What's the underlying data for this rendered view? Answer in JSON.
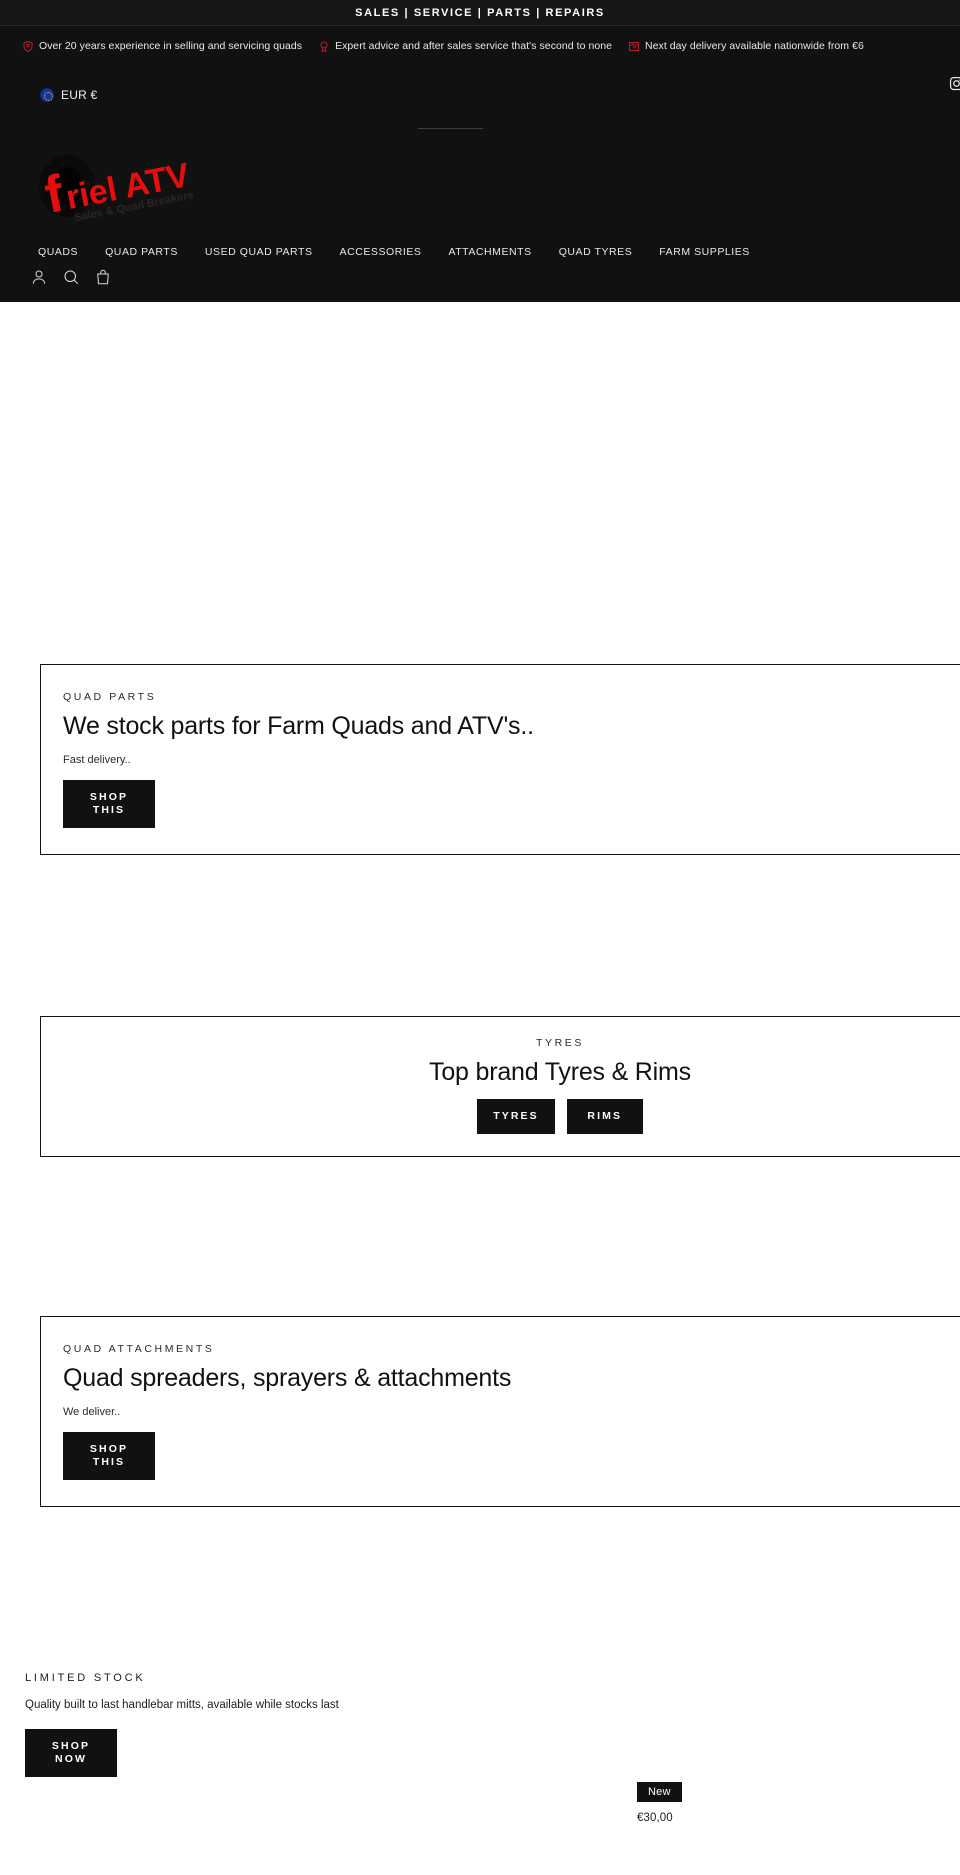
{
  "announcement": {
    "text": "SALES | SERVICE | PARTS | REPAIRS"
  },
  "usp": {
    "items": [
      {
        "icon": "shield-icon",
        "text": "Over 20 years experience in selling and servicing quads"
      },
      {
        "icon": "medal-icon",
        "text": "Expert advice and after sales service that's second to none"
      },
      {
        "icon": "delivery-box-icon",
        "text": "Next day delivery available nationwide from €6"
      }
    ]
  },
  "utility": {
    "currency": {
      "label": "EUR €",
      "flag": "eu-flag-icon"
    },
    "socials": [
      {
        "icon": "instagram-icon",
        "name": "Instagram"
      }
    ]
  },
  "logo": {
    "word_f": "f",
    "word_main": "riel ATV",
    "tagline": "Sales & Quad Breakers",
    "color": "#e80d0d"
  },
  "nav": {
    "items": [
      {
        "label": "QUADS"
      },
      {
        "label": "QUAD PARTS"
      },
      {
        "label": "USED QUAD PARTS"
      },
      {
        "label": "ACCESSORIES"
      },
      {
        "label": "ATTACHMENTS"
      },
      {
        "label": "QUAD TYRES"
      },
      {
        "label": "FARM SUPPLIES"
      }
    ]
  },
  "header_tools": [
    {
      "icon": "account-icon",
      "name": "Account"
    },
    {
      "icon": "search-icon",
      "name": "Search"
    },
    {
      "icon": "cart-icon",
      "name": "Cart"
    }
  ],
  "promos": [
    {
      "id": "quad-parts",
      "eyebrow": "QUAD PARTS",
      "heading": "We stock parts for Farm Quads and ATV's..",
      "sub": "Fast delivery..",
      "button_line1": "SHOP",
      "button_line2": "THIS"
    },
    {
      "id": "tyres",
      "eyebrow": "TYRES",
      "heading": "Top brand Tyres & Rims",
      "button_tyres": "TYRES",
      "button_rims": "RIMS"
    },
    {
      "id": "attachments",
      "eyebrow": "QUAD ATTACHMENTS",
      "heading": "Quad spreaders, sprayers & attachments",
      "sub": "We deliver..",
      "button_line1": "SHOP",
      "button_line2": "THIS"
    }
  ],
  "limited_stock": {
    "eyebrow": "LIMITED STOCK",
    "text": "Quality built to last handlebar mitts, available while stocks last",
    "button_line1": "SHOP",
    "button_line2": "NOW"
  },
  "product_teaser": {
    "badge": "New",
    "price": "€30,00"
  },
  "colors": {
    "header_bg": "#111111",
    "accent_red": "#e80d0d",
    "usp_icon_red": "#b3202b",
    "button_bg": "#111111",
    "page_bg": "#ffffff"
  }
}
